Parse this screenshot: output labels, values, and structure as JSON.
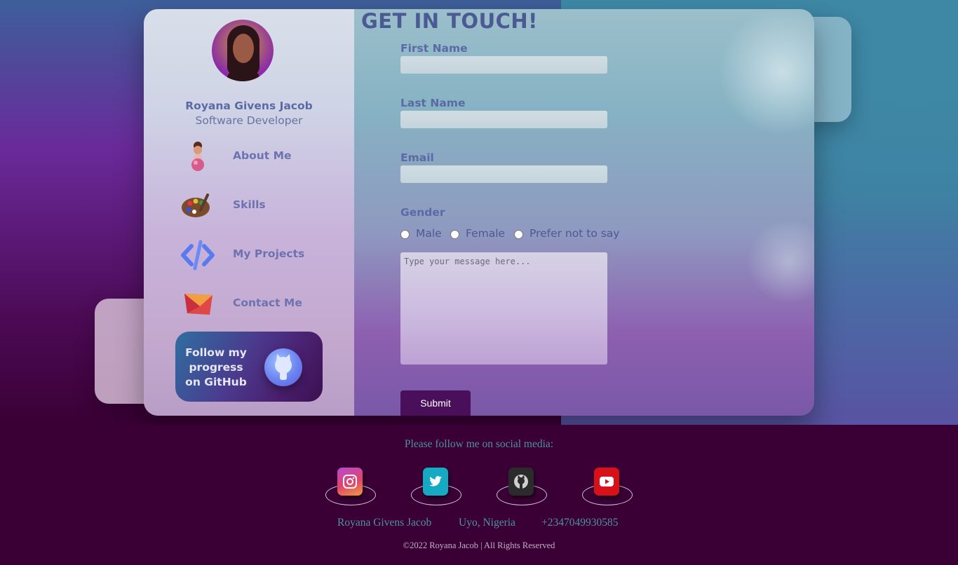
{
  "profile": {
    "name": "Royana Givens Jacob",
    "role": "Software Developer"
  },
  "nav": [
    {
      "label": "About Me",
      "icon": "person-figure-icon"
    },
    {
      "label": "Skills",
      "icon": "paint-palette-icon"
    },
    {
      "label": "My Projects",
      "icon": "code-brackets-icon"
    },
    {
      "label": "Contact Me",
      "icon": "envelope-icon"
    }
  ],
  "github_button": {
    "label": "Follow my progress on GitHub",
    "icon": "github-octocat-icon"
  },
  "form": {
    "title": "GET IN TOUCH!",
    "first_name_label": "First Name",
    "first_name_value": "",
    "last_name_label": "Last Name",
    "last_name_value": "",
    "email_label": "Email",
    "email_value": "",
    "gender_label": "Gender",
    "gender_options": [
      "Male",
      "Female",
      "Prefer not to say"
    ],
    "message_placeholder": "Type your message here...",
    "submit_label": "Submit"
  },
  "footer": {
    "follow_text": "Please follow me on social media:",
    "social": [
      {
        "name": "instagram",
        "icon": "instagram-icon",
        "color": "#e2436b"
      },
      {
        "name": "twitter",
        "icon": "twitter-icon",
        "color": "#16a9c4"
      },
      {
        "name": "github",
        "icon": "github-icon",
        "color": "#2b2b2b"
      },
      {
        "name": "youtube",
        "icon": "youtube-icon",
        "color": "#d8101a"
      }
    ],
    "contact_name": "Royana Givens Jacob",
    "contact_location": "Uyo, Nigeria",
    "contact_phone": "+2347049930585",
    "copyright": "©2022 Royana Jacob | All Rights Reserved"
  },
  "colors": {
    "accent": "#5b6aa5",
    "button": "#4a0f5a",
    "footer_bg": "#3a0035",
    "footer_text": "#4f90a2"
  }
}
